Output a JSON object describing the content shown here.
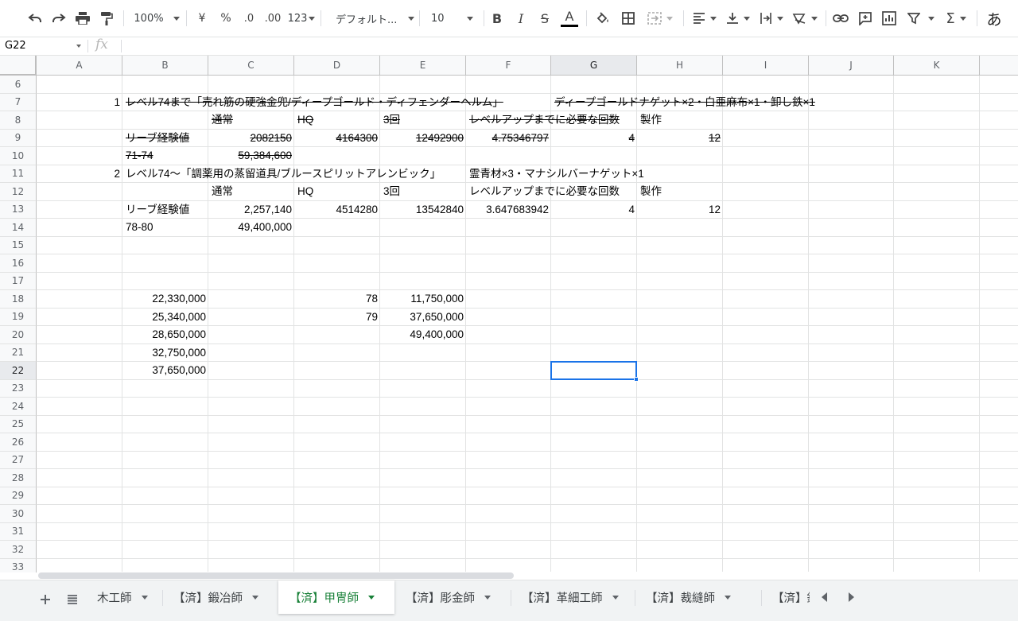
{
  "toolbar": {
    "zoom": "100%",
    "currency": "¥",
    "percent": "%",
    "dec_decrease": ".0",
    "dec_increase": ".00",
    "more_formats": "123",
    "font": "デフォルト...",
    "font_size": "10",
    "bold": "B",
    "italic": "I",
    "strike": "S",
    "text_color": "A",
    "sum": "Σ",
    "input_tool": "あ"
  },
  "formula_bar": {
    "name_box": "G22",
    "fx": "fx",
    "value": ""
  },
  "columns": [
    "A",
    "B",
    "C",
    "D",
    "E",
    "F",
    "G",
    "H",
    "I",
    "J",
    "K"
  ],
  "rows": [
    6,
    7,
    8,
    9,
    10,
    11,
    12,
    13,
    14,
    15,
    16,
    17,
    18,
    19,
    20,
    21,
    22,
    23,
    24,
    25,
    26,
    27,
    28,
    29,
    30,
    31,
    32,
    33
  ],
  "cells": {
    "A7": "1",
    "B7": "レベル74まで「売れ筋の硬強金兜/ディープゴールド・ディフェンダーヘルム」",
    "G7": "ディープゴールドナゲット×2・白亜麻布×1・卸し鉄×1",
    "C8": "通常",
    "D8": "HQ",
    "E8": "3回",
    "F8": "レベルアップまでに必要な回数",
    "H8": "製作",
    "B9": "リーブ経験値",
    "C9": "2082150",
    "D9": "4164300",
    "E9": "12492900",
    "F9": "4.75346797",
    "G9": "4",
    "H9": "12",
    "B10": "71-74",
    "C10": "59,384,600",
    "A11": "2",
    "B11": "レベル74〜「調薬用の蒸留道具/ブルースピリットアレンビック」",
    "F11": "霊青材×3・マナシルバーナゲット×1",
    "C12": "通常",
    "D12": "HQ",
    "E12": "3回",
    "F12": "レベルアップまでに必要な回数",
    "H12": "製作",
    "B13": "リーブ経験値",
    "C13": "2,257,140",
    "D13": "4514280",
    "E13": "13542840",
    "F13": "3.647683942",
    "G13": "4",
    "H13": "12",
    "B14": "78-80",
    "C14": "49,400,000",
    "B18": "22,330,000",
    "D18": "78",
    "E18": "11,750,000",
    "B19": "25,340,000",
    "D19": "79",
    "E19": "37,650,000",
    "B20": "28,650,000",
    "E20": "49,400,000",
    "B21": "32,750,000",
    "B22": "37,650,000"
  },
  "selected_cell": "G22",
  "sheet_tabs": [
    {
      "label": "木工師",
      "active": false
    },
    {
      "label": "【済】鍛冶師",
      "active": false
    },
    {
      "label": "【済】甲冑師",
      "active": true
    },
    {
      "label": "【済】彫金師",
      "active": false
    },
    {
      "label": "【済】革細工師",
      "active": false
    },
    {
      "label": "【済】裁縫師",
      "active": false
    },
    {
      "label": "【済】錬",
      "active": false
    }
  ],
  "colors": {
    "active_tab": "#188038",
    "selection": "#1a73e8"
  }
}
